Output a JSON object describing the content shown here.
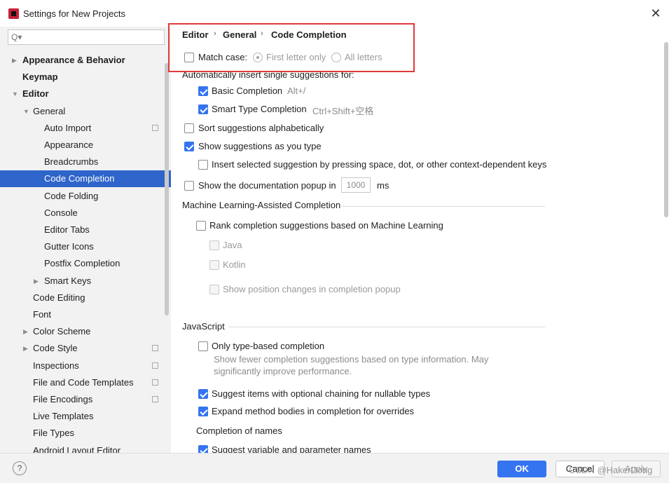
{
  "window": {
    "title": "Settings for New Projects",
    "close_icon": "close-icon"
  },
  "sidebar": {
    "search_placeholder": "Q▾",
    "items": [
      {
        "label": "Appearance & Behavior",
        "level": 0,
        "arrow": "▶",
        "bold": true
      },
      {
        "label": "Keymap",
        "level": 0,
        "arrow": "",
        "bold": true
      },
      {
        "label": "Editor",
        "level": 0,
        "arrow": "▼",
        "bold": true
      },
      {
        "label": "General",
        "level": 1,
        "arrow": "▼"
      },
      {
        "label": "Auto Import",
        "level": 2,
        "arrow": "",
        "project": true
      },
      {
        "label": "Appearance",
        "level": 2,
        "arrow": ""
      },
      {
        "label": "Breadcrumbs",
        "level": 2,
        "arrow": ""
      },
      {
        "label": "Code Completion",
        "level": 2,
        "arrow": "",
        "selected": true
      },
      {
        "label": "Code Folding",
        "level": 2,
        "arrow": ""
      },
      {
        "label": "Console",
        "level": 2,
        "arrow": ""
      },
      {
        "label": "Editor Tabs",
        "level": 2,
        "arrow": ""
      },
      {
        "label": "Gutter Icons",
        "level": 2,
        "arrow": ""
      },
      {
        "label": "Postfix Completion",
        "level": 2,
        "arrow": ""
      },
      {
        "label": "Smart Keys",
        "level": 2,
        "arrow": "▶"
      },
      {
        "label": "Code Editing",
        "level": 1,
        "arrow": ""
      },
      {
        "label": "Font",
        "level": 1,
        "arrow": ""
      },
      {
        "label": "Color Scheme",
        "level": 1,
        "arrow": "▶"
      },
      {
        "label": "Code Style",
        "level": 1,
        "arrow": "▶",
        "project": true
      },
      {
        "label": "Inspections",
        "level": 1,
        "arrow": "",
        "project": true
      },
      {
        "label": "File and Code Templates",
        "level": 1,
        "arrow": "",
        "project": true
      },
      {
        "label": "File Encodings",
        "level": 1,
        "arrow": "",
        "project": true
      },
      {
        "label": "Live Templates",
        "level": 1,
        "arrow": ""
      },
      {
        "label": "File Types",
        "level": 1,
        "arrow": ""
      },
      {
        "label": "Android Layout Editor",
        "level": 1,
        "arrow": ""
      }
    ]
  },
  "breadcrumb": {
    "items": [
      "Editor",
      "General",
      "Code Completion"
    ],
    "separator": "›"
  },
  "settings": {
    "match_case": {
      "label": "Match case:",
      "checked": false
    },
    "radio_first_letter": {
      "label": "First letter only",
      "selected": true
    },
    "radio_all_letters": {
      "label": "All letters",
      "selected": false
    },
    "auto_insert_header": "Automatically insert single suggestions for:",
    "basic_completion": {
      "label": "Basic Completion",
      "shortcut": "Alt+/",
      "checked": true
    },
    "smart_type_completion": {
      "label": "Smart Type Completion",
      "shortcut": "Ctrl+Shift+空格",
      "checked": true
    },
    "sort_alpha": {
      "label": "Sort suggestions alphabetically",
      "checked": false
    },
    "show_as_type": {
      "label": "Show suggestions as you type",
      "checked": true
    },
    "insert_selected": {
      "label": "Insert selected suggestion by pressing space, dot, or other context-dependent keys",
      "checked": false
    },
    "doc_popup": {
      "label": "Show the documentation popup in",
      "value": "1000",
      "unit": "ms",
      "checked": false
    },
    "ml_header": "Machine Learning-Assisted Completion",
    "ml_rank": {
      "label": "Rank completion suggestions based on Machine Learning",
      "checked": false
    },
    "ml_java": {
      "label": "Java"
    },
    "ml_kotlin": {
      "label": "Kotlin"
    },
    "ml_show_pos": {
      "label": "Show position changes in completion popup"
    },
    "js_header": "JavaScript",
    "js_type_based": {
      "label": "Only type-based completion",
      "checked": false
    },
    "js_type_based_desc_1": "Show fewer completion suggestions based on type information. May",
    "js_type_based_desc_2": "significantly improve performance.",
    "js_optional_chaining": {
      "label": "Suggest items with optional chaining for nullable types",
      "checked": true
    },
    "js_expand_method": {
      "label": "Expand method bodies in completion for overrides",
      "checked": true
    },
    "completion_of_names": "Completion of names",
    "suggest_var_names": {
      "label": "Suggest variable and parameter names",
      "checked": true
    }
  },
  "footer": {
    "help_label": "?",
    "ok_label": "OK",
    "cancel_label": "Cancel",
    "apply_label": "Apply",
    "watermark": "CSDN @HakerDong"
  },
  "colors": {
    "accent": "#3574f0",
    "selection": "#2f65ca",
    "highlight_box": "#e03a3a"
  }
}
